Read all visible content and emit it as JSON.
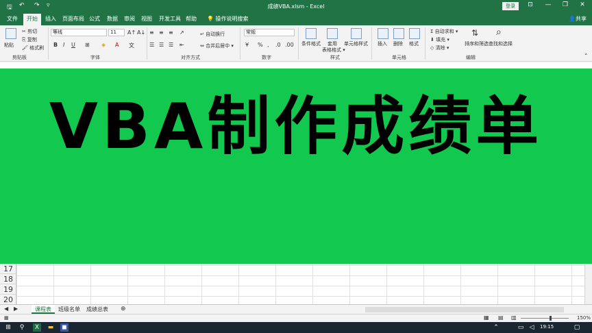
{
  "titlebar": {
    "title": "成绩VBA.xlsm  -  Excel",
    "login": "登录",
    "save_icon": "save-icon",
    "undo_icon": "undo-icon",
    "redo_icon": "redo-icon",
    "minimize": "—",
    "restore": "❐",
    "close": "✕",
    "ribbon_options": "⊡"
  },
  "tabs": [
    "文件",
    "开始",
    "插入",
    "页面布局",
    "公式",
    "数据",
    "审阅",
    "视图",
    "开发工具",
    "帮助"
  ],
  "tellme": "操作说明搜索",
  "share": "共享",
  "ribbon": {
    "clipboard": {
      "label": "剪贴板",
      "cut": "剪切",
      "copy": "复制",
      "format_painter": "格式刷",
      "paste": "粘贴"
    },
    "font": {
      "label": "字体",
      "name": "等线",
      "size": "11",
      "bold": "B",
      "italic": "I",
      "underline": "U"
    },
    "alignment": {
      "label": "对齐方式",
      "wrap": "自动换行",
      "merge": "合并后居中"
    },
    "number": {
      "label": "数字",
      "format": "常规",
      "percent": "%"
    },
    "styles": {
      "label": "样式",
      "conditional": "条件格式",
      "table": "套用\n表格格式",
      "cell_styles": "单元格样式"
    },
    "cells": {
      "label": "单元格",
      "insert": "插入",
      "delete": "删除",
      "format": "格式"
    },
    "editing": {
      "label": "编辑",
      "autosum": "自动求和",
      "fill": "填充",
      "clear": "清除",
      "sort": "排序和筛选",
      "find": "查找和选择"
    }
  },
  "banner": {
    "text": "VBA制作成绩单"
  },
  "rows": [
    "17",
    "18",
    "19",
    "20"
  ],
  "sheet_tabs": [
    "课程表",
    "班级名单",
    "成绩总表"
  ],
  "add_sheet": "⊕",
  "statusbar": {
    "zoom": "150%"
  },
  "taskbar": {
    "time": "19:15"
  }
}
